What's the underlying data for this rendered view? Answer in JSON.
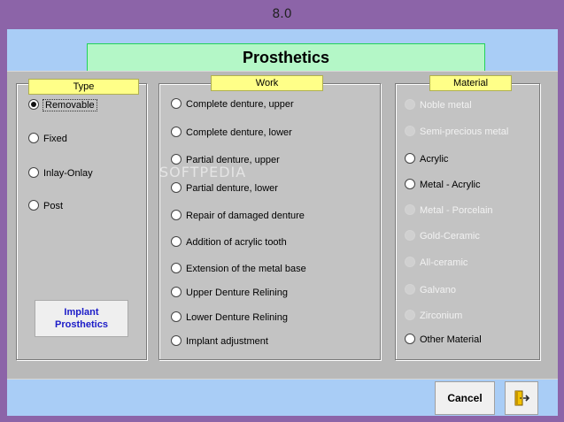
{
  "window": {
    "title": "8.0"
  },
  "header": {
    "title": "Prosthetics"
  },
  "type_group": {
    "label": "Type",
    "options": [
      {
        "label": "Removable",
        "checked": true,
        "disabled": false
      },
      {
        "label": "Fixed",
        "checked": false,
        "disabled": false
      },
      {
        "label": "Inlay-Onlay",
        "checked": false,
        "disabled": false
      },
      {
        "label": "Post",
        "checked": false,
        "disabled": false
      }
    ],
    "implant_button": {
      "line1": "Implant",
      "line2": "Prosthetics"
    }
  },
  "work_group": {
    "label": "Work",
    "options": [
      {
        "label": "Complete denture, upper"
      },
      {
        "label": "Complete denture, lower"
      },
      {
        "label": "Partial denture, upper"
      },
      {
        "label": "Partial denture, lower"
      },
      {
        "label": "Repair of damaged denture"
      },
      {
        "label": "Addition of acrylic tooth"
      },
      {
        "label": "Extension of the metal base"
      },
      {
        "label": "Upper Denture Relining"
      },
      {
        "label": "Lower Denture Relining"
      },
      {
        "label": "Implant adjustment"
      }
    ]
  },
  "material_group": {
    "label": "Material",
    "options": [
      {
        "label": "Noble metal",
        "disabled": true
      },
      {
        "label": "Semi-precious metal",
        "disabled": true
      },
      {
        "label": "Acrylic",
        "disabled": false
      },
      {
        "label": "Metal - Acrylic",
        "disabled": false
      },
      {
        "label": "Metal - Porcelain",
        "disabled": true
      },
      {
        "label": "Gold-Ceramic",
        "disabled": true
      },
      {
        "label": "All-ceramic",
        "disabled": true
      },
      {
        "label": "Galvano",
        "disabled": true
      },
      {
        "label": "Zirconium",
        "disabled": true
      },
      {
        "label": "Other Material",
        "disabled": false
      }
    ]
  },
  "footer": {
    "cancel_label": "Cancel",
    "exit_icon": "exit-door-icon"
  },
  "watermark": "SOFTPEDIA"
}
